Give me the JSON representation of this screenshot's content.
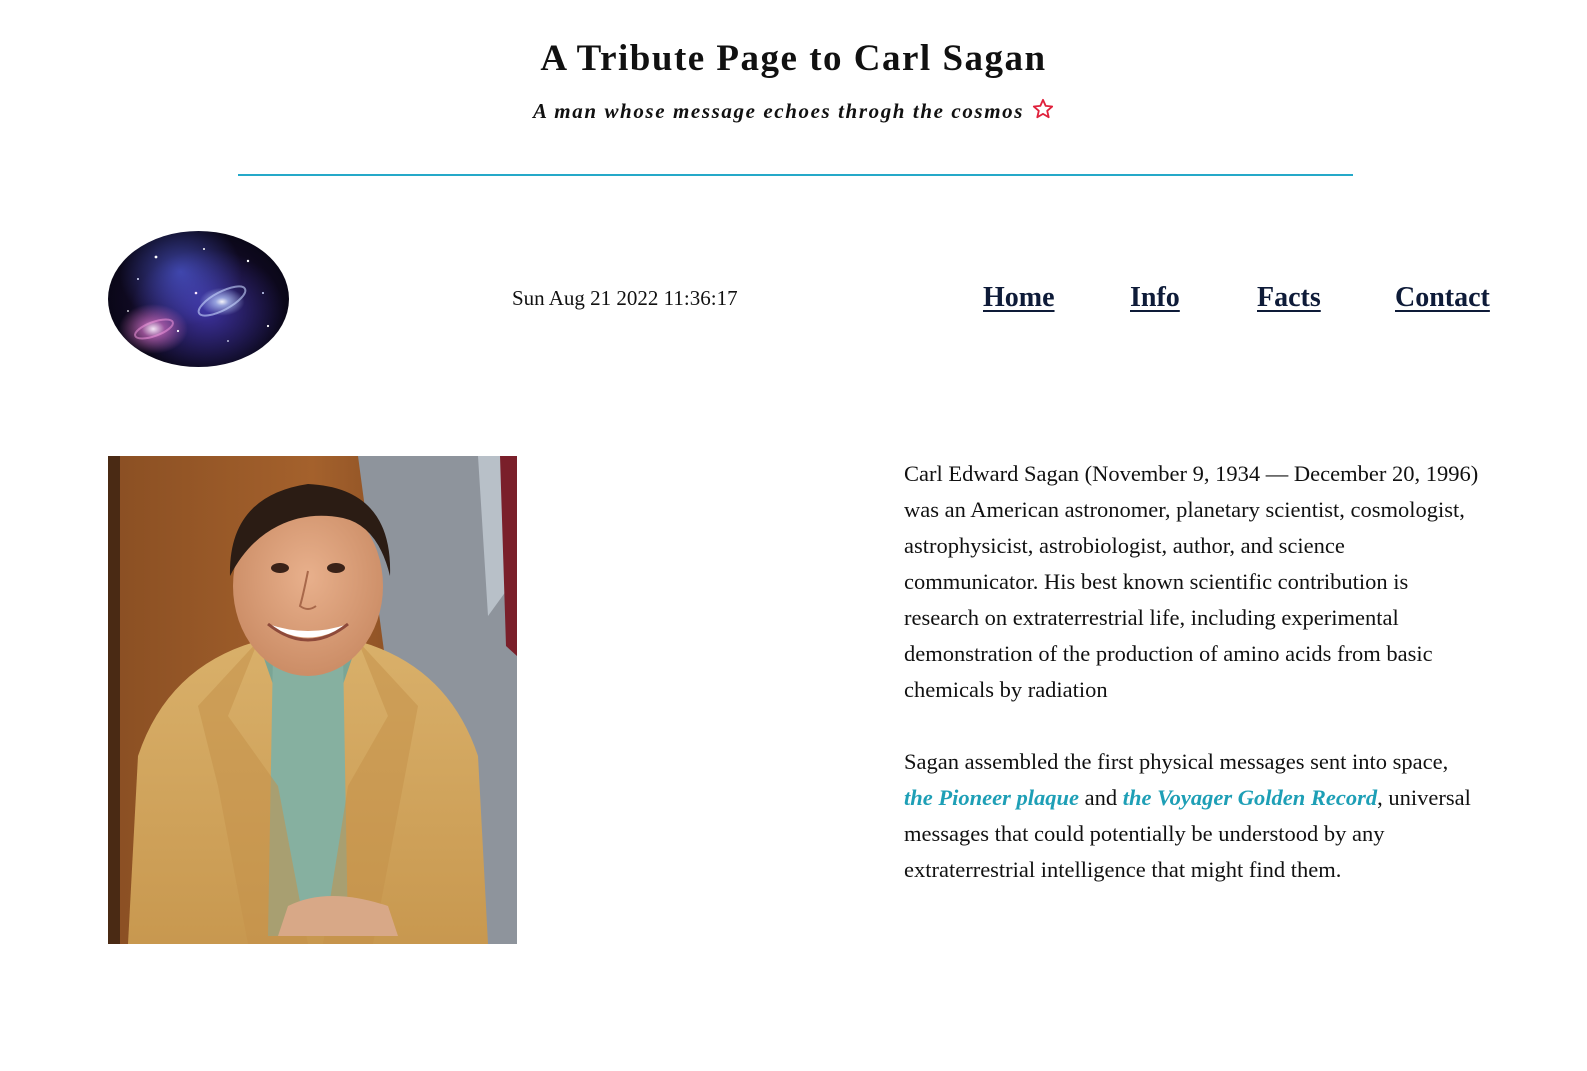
{
  "header": {
    "title": "A Tribute Page to Carl Sagan",
    "tagline": "A man whose message echoes throgh the cosmos",
    "star_icon": "star-outline-icon",
    "accent_color": "#e0213c",
    "divider_color": "#25a9c9"
  },
  "topbar": {
    "logo_icon": "galaxy-logo-image",
    "datetime": "Sun Aug 21 2022 11:36:17",
    "nav": [
      {
        "label": "Home"
      },
      {
        "label": "Info"
      },
      {
        "label": "Facts"
      },
      {
        "label": "Contact"
      }
    ]
  },
  "main": {
    "portrait_icon": "carl-sagan-portrait-image",
    "bio": "Carl Edward Sagan (November 9, 1934 — December 20, 1996) was an American astronomer, planetary scientist, cosmologist, astrophysicist, astrobiologist, author, and science communicator. His best known scientific contribution is research on extraterrestrial life, including experimental demonstration of the production of amino acids from basic chemicals by radiation",
    "messages": {
      "before": "Sagan assembled the first physical messages sent into space, ",
      "link1": "the Pioneer plaque",
      "middle": " and ",
      "link2": "the Voyager Golden Record",
      "after": ", universal messages that could potentially be understood by any extraterrestrial intelligence that might find them."
    },
    "link_color": "#1e9fb6"
  }
}
